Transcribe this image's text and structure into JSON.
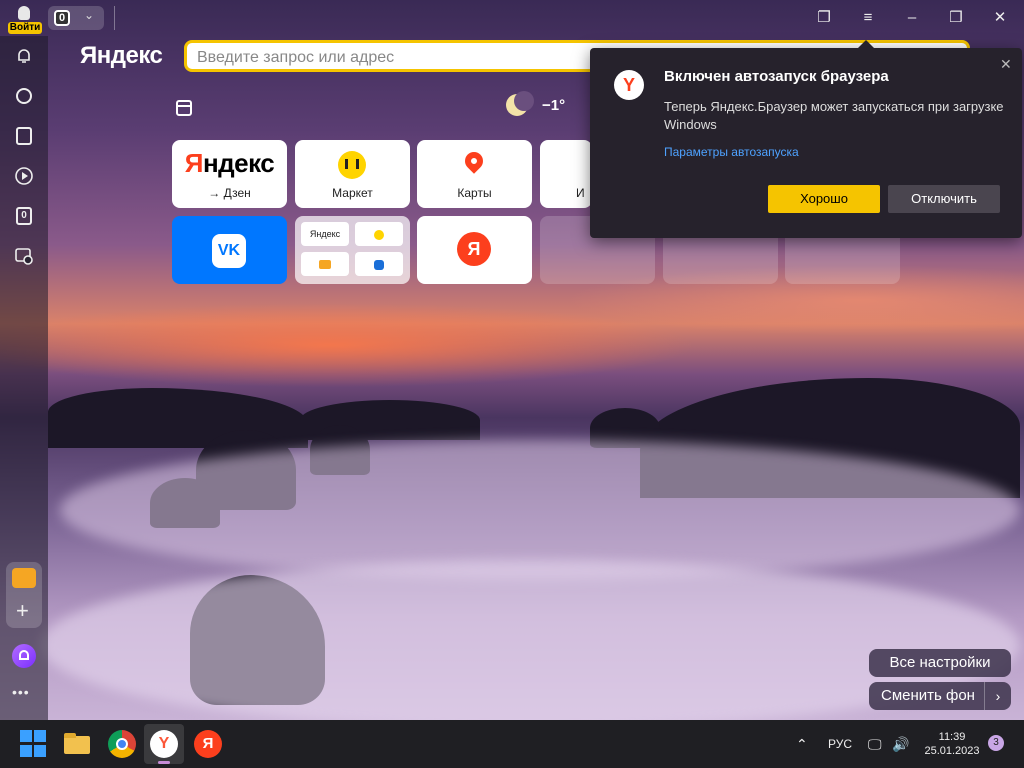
{
  "profile": {
    "login_label": "Войти"
  },
  "tabs": {
    "count": "0"
  },
  "brand": {
    "logo": "Яндекс"
  },
  "search": {
    "placeholder": "Введите запрос или адрес"
  },
  "weather": {
    "temp": "−1°"
  },
  "tiles": [
    {
      "name": "yandex-dzen",
      "label": "→ Дзен",
      "logo_first": "Я",
      "logo_rest": "ндекс"
    },
    {
      "name": "market",
      "label": "Маркет"
    },
    {
      "name": "maps",
      "label": "Карты"
    },
    {
      "name": "partial",
      "label": "И"
    }
  ],
  "group_tile": {
    "mini_label": "Яндекс"
  },
  "vk_tile": {
    "label": "VK"
  },
  "ya_tile": {
    "label": "Я"
  },
  "notification": {
    "title": "Включен автозапуск браузера",
    "text": "Теперь Яндекс.Браузер может запускаться при загрузке Windows",
    "link": "Параметры автозапуска",
    "ok": "Хорошо",
    "off": "Отключить"
  },
  "bottom": {
    "all_settings": "Все настройки",
    "change_bg": "Сменить фон"
  },
  "sidebar": {
    "counter": "0",
    "more": "•••"
  },
  "taskbar": {
    "lang": "РУС",
    "time": "11:39",
    "date": "25.01.2023",
    "notif_count": "3"
  },
  "colors": {
    "accent": "#f5c400",
    "yandex_red": "#fc3f1d",
    "link": "#4ea2ff"
  }
}
